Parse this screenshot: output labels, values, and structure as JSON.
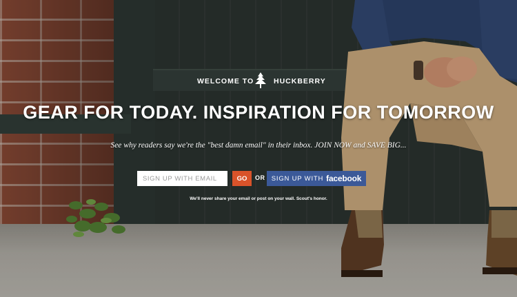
{
  "brand": {
    "prefix": "WELCOME TO",
    "name": "HUCKBERRY",
    "logo_icon": "tree-icon"
  },
  "hero": {
    "headline": "GEAR FOR TODAY. INSPIRATION FOR TOMORROW",
    "subheadline": "See why readers say we're the \"best damn email\" in their inbox. JOIN NOW and SAVE BIG...",
    "privacy_note": "We'll never share your email or post on your wall. Scout's honor."
  },
  "signup": {
    "email_placeholder": "SIGN UP WITH EMAIL",
    "go_label": "GO",
    "or_label": "OR",
    "facebook_prefix": "SIGN UP WITH",
    "facebook_word": "facebook"
  },
  "colors": {
    "go_button": "#d9532a",
    "facebook_button": "#3b5998",
    "text": "#ffffff"
  }
}
